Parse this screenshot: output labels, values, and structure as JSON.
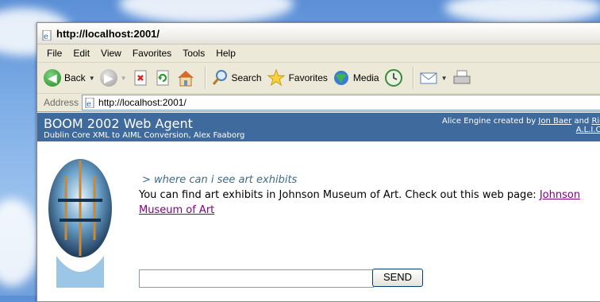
{
  "window": {
    "title": "http://localhost:2001/"
  },
  "menu": [
    "File",
    "Edit",
    "View",
    "Favorites",
    "Tools",
    "Help"
  ],
  "toolbar": {
    "back": "Back",
    "search": "Search",
    "favorites": "Favorites",
    "media": "Media"
  },
  "address": {
    "label": "Address",
    "url": "http://localhost:2001/"
  },
  "banner": {
    "title": "BOOM 2002 Web Agent",
    "subtitle": "Dublin Core XML to AIML Conversion, Alex Faaborg",
    "credit_prefix": "Alice Engine created by ",
    "credit_name1": "Jon Baer",
    "credit_and": " and ",
    "credit_name2": "Rich",
    "credit_line2": "A.L.I.C.E"
  },
  "chat": {
    "query": "> where can i see art exhibits",
    "answer_text": "You can find art exhibits in Johnson Museum of Art. Check out this web page: ",
    "answer_link": "Johnson Museum of Art",
    "input_value": "",
    "send_label": "SEND"
  },
  "colors": {
    "banner": "#3e6a9e",
    "link_visited": "#800080",
    "query": "#3a6b8a"
  }
}
